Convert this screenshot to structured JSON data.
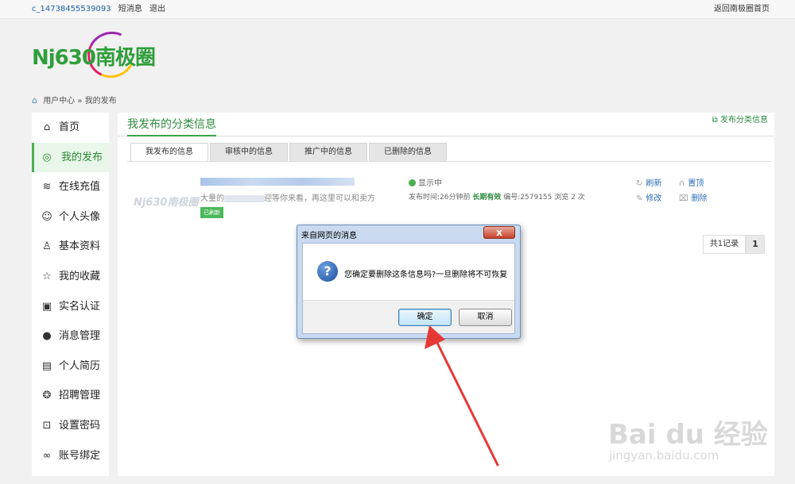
{
  "topbar": {
    "user": "c_14738455539093",
    "messages": "短消息",
    "logout": "退出",
    "home_link": "返回南极圈首页"
  },
  "logo": {
    "text": "Nj630南极圈"
  },
  "breadcrumb": {
    "home": "用户中心",
    "sep": "»",
    "current": "我的发布"
  },
  "sidebar": {
    "items": [
      {
        "label": "首页",
        "icon": "home-icon",
        "glyph": "⌂"
      },
      {
        "label": "我的发布",
        "icon": "publish-icon",
        "glyph": "◎"
      },
      {
        "label": "在线充值",
        "icon": "recharge-icon",
        "glyph": "≋"
      },
      {
        "label": "个人头像",
        "icon": "avatar-icon",
        "glyph": "☺"
      },
      {
        "label": "基本资料",
        "icon": "profile-icon",
        "glyph": "♙"
      },
      {
        "label": "我的收藏",
        "icon": "star-icon",
        "glyph": "☆"
      },
      {
        "label": "实名认证",
        "icon": "id-card-icon",
        "glyph": "▣"
      },
      {
        "label": "消息管理",
        "icon": "message-icon",
        "glyph": "●"
      },
      {
        "label": "个人简历",
        "icon": "resume-icon",
        "glyph": "▤"
      },
      {
        "label": "招聘管理",
        "icon": "recruit-icon",
        "glyph": "❂"
      },
      {
        "label": "设置密码",
        "icon": "lock-icon",
        "glyph": "⊡"
      },
      {
        "label": "账号绑定",
        "icon": "link-icon",
        "glyph": "∞"
      }
    ]
  },
  "main": {
    "title": "我发布的分类信息",
    "publish_link": "发布分类信息",
    "tabs": [
      {
        "label": "我发布的信息"
      },
      {
        "label": "审核中的信息"
      },
      {
        "label": "推广中的信息"
      },
      {
        "label": "已删除的信息"
      }
    ],
    "item": {
      "watermark": "Nj630南极圈",
      "desc_pre": "大量的",
      "desc_post": "迎等你来看，再这里可以和卖方",
      "badge": "已刷新",
      "status": "显示中",
      "meta_pre": "发布时间:26分钟前",
      "meta_valid": "长期有效",
      "meta_post": "编号:2579155 浏览 2 次",
      "refresh": "刷新",
      "top": "置顶",
      "edit": "修改",
      "delete": "删除"
    },
    "pager": {
      "total": "共1记录",
      "page": "1"
    }
  },
  "dialog": {
    "title": "来自网页的消息",
    "close": "x",
    "message": "您确定要删除这条信息吗?一旦删除将不可恢复",
    "ok": "确定",
    "cancel": "取消"
  },
  "watermark": {
    "main": "Bai du 经验",
    "sub": "jingyan.baidu.com"
  },
  "colors": {
    "accent": "#3aa54a",
    "link": "#2a6db5",
    "arrow": "#e53935"
  }
}
